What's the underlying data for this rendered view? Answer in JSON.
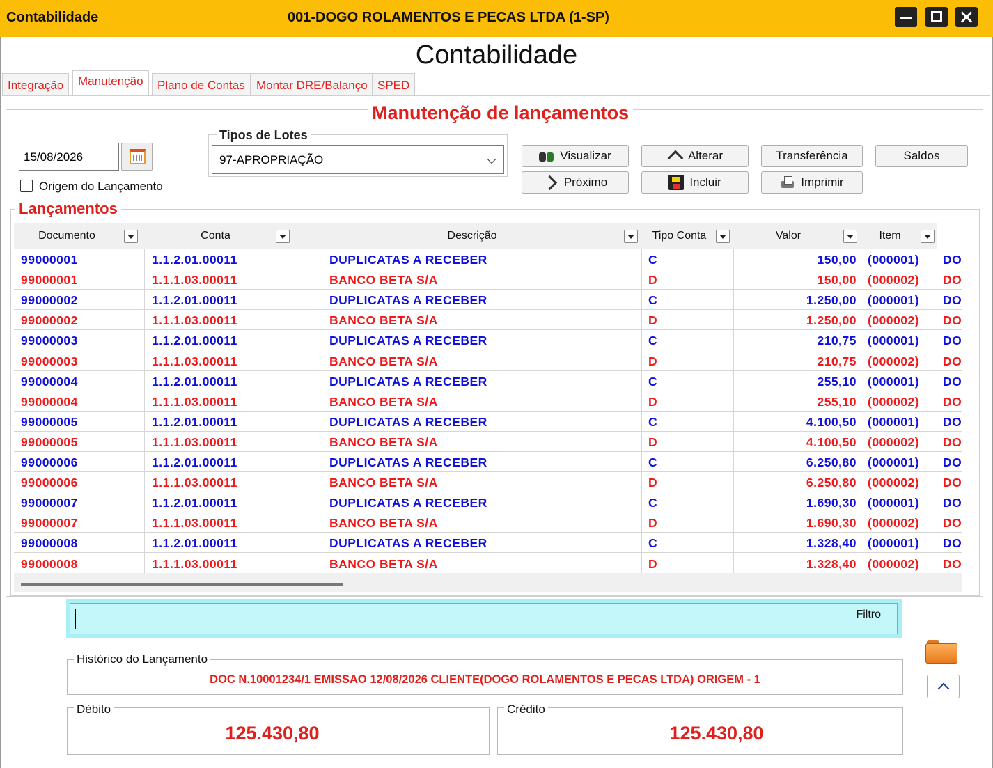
{
  "window": {
    "app_title": "Contabilidade",
    "company": "001-DOGO ROLAMENTOS E PECAS LTDA (1-SP)"
  },
  "page_title": "Contabilidade",
  "tabs": [
    {
      "label": "Integração",
      "active": false
    },
    {
      "label": "Manutenção",
      "active": true
    },
    {
      "label": "Plano de Contas",
      "active": false
    },
    {
      "label": "Montar DRE/Balanço",
      "active": false
    },
    {
      "label": "SPED",
      "active": false
    }
  ],
  "section_title": "Manutenção de lançamentos",
  "date_value": "15/08/2026",
  "origem_label": "Origem do Lançamento",
  "origem_checked": false,
  "lotes": {
    "title": "Tipos de Lotes",
    "selected": "97-APROPRIAÇÃO"
  },
  "buttons": {
    "visualizar": "Visualizar",
    "alterar": "Alterar",
    "transferencia": "Transferência",
    "saldos": "Saldos",
    "proximo": "Próximo",
    "incluir": "Incluir",
    "imprimir": "Imprimir"
  },
  "lancamentos_title": "Lançamentos",
  "columns": [
    "Documento",
    "Conta",
    "Descrição",
    "Tipo Conta",
    "Valor",
    "Item"
  ],
  "rows": [
    {
      "doc": "99000001",
      "conta": "1.1.2.01.00011",
      "desc": "DUPLICATAS A RECEBER",
      "tipo": "C",
      "valor": "150,00",
      "item": "(000001)",
      "extra": "DO"
    },
    {
      "doc": "99000001",
      "conta": "1.1.1.03.00011",
      "desc": "BANCO BETA S/A",
      "tipo": "D",
      "valor": "150,00",
      "item": "(000002)",
      "extra": "DO"
    },
    {
      "doc": "99000002",
      "conta": "1.1.2.01.00011",
      "desc": "DUPLICATAS A RECEBER",
      "tipo": "C",
      "valor": "1.250,00",
      "item": "(000001)",
      "extra": "DO"
    },
    {
      "doc": "99000002",
      "conta": "1.1.1.03.00011",
      "desc": "BANCO BETA S/A",
      "tipo": "D",
      "valor": "1.250,00",
      "item": "(000002)",
      "extra": "DO"
    },
    {
      "doc": "99000003",
      "conta": "1.1.2.01.00011",
      "desc": "DUPLICATAS A RECEBER",
      "tipo": "C",
      "valor": "210,75",
      "item": "(000001)",
      "extra": "DO"
    },
    {
      "doc": "99000003",
      "conta": "1.1.1.03.00011",
      "desc": "BANCO BETA S/A",
      "tipo": "D",
      "valor": "210,75",
      "item": "(000002)",
      "extra": "DO"
    },
    {
      "doc": "99000004",
      "conta": "1.1.2.01.00011",
      "desc": "DUPLICATAS A RECEBER",
      "tipo": "C",
      "valor": "255,10",
      "item": "(000001)",
      "extra": "DO"
    },
    {
      "doc": "99000004",
      "conta": "1.1.1.03.00011",
      "desc": "BANCO BETA S/A",
      "tipo": "D",
      "valor": "255,10",
      "item": "(000002)",
      "extra": "DO"
    },
    {
      "doc": "99000005",
      "conta": "1.1.2.01.00011",
      "desc": "DUPLICATAS A RECEBER",
      "tipo": "C",
      "valor": "4.100,50",
      "item": "(000001)",
      "extra": "DO"
    },
    {
      "doc": "99000005",
      "conta": "1.1.1.03.00011",
      "desc": "BANCO BETA S/A",
      "tipo": "D",
      "valor": "4.100,50",
      "item": "(000002)",
      "extra": "DO"
    },
    {
      "doc": "99000006",
      "conta": "1.1.2.01.00011",
      "desc": "DUPLICATAS A RECEBER",
      "tipo": "C",
      "valor": "6.250,80",
      "item": "(000001)",
      "extra": "DO"
    },
    {
      "doc": "99000006",
      "conta": "1.1.1.03.00011",
      "desc": "BANCO BETA S/A",
      "tipo": "D",
      "valor": "6.250,80",
      "item": "(000002)",
      "extra": "DO"
    },
    {
      "doc": "99000007",
      "conta": "1.1.2.01.00011",
      "desc": "DUPLICATAS A RECEBER",
      "tipo": "C",
      "valor": "1.690,30",
      "item": "(000001)",
      "extra": "DO"
    },
    {
      "doc": "99000007",
      "conta": "1.1.1.03.00011",
      "desc": "BANCO BETA S/A",
      "tipo": "D",
      "valor": "1.690,30",
      "item": "(000002)",
      "extra": "DO"
    },
    {
      "doc": "99000008",
      "conta": "1.1.2.01.00011",
      "desc": "DUPLICATAS A RECEBER",
      "tipo": "C",
      "valor": "1.328,40",
      "item": "(000001)",
      "extra": "DO"
    },
    {
      "doc": "99000008",
      "conta": "1.1.1.03.00011",
      "desc": "BANCO BETA S/A",
      "tipo": "D",
      "valor": "1.328,40",
      "item": "(000002)",
      "extra": "DO"
    }
  ],
  "filter": {
    "label": "Filtro",
    "value": ""
  },
  "historico": {
    "title": "Histórico do Lançamento",
    "text": "DOC N.10001234/1 EMISSAO 12/08/2026 CLIENTE(DOGO ROLAMENTOS E PECAS LTDA) ORIGEM - 1"
  },
  "debito": {
    "label": "Débito",
    "value": "125.430,80"
  },
  "credito": {
    "label": "Crédito",
    "value": "125.430,80"
  },
  "colors": {
    "title_bar": "#fbbd06",
    "accent_red": "#e0201c",
    "credit_blue": "#1010dd",
    "debit_red": "#f01818",
    "filter_bg": "#c3f7fa"
  }
}
